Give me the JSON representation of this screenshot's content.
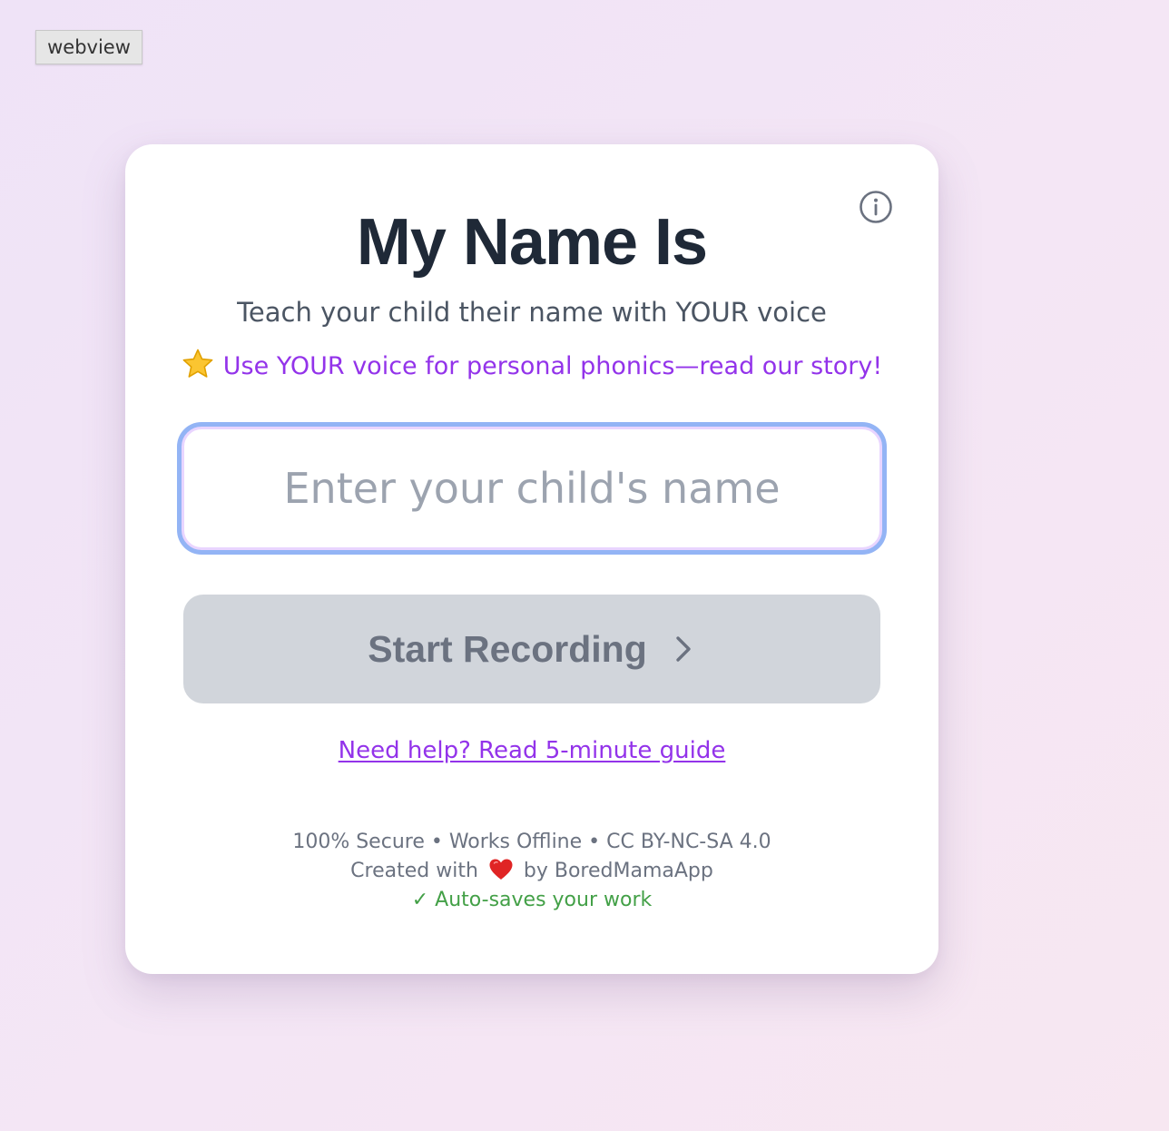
{
  "webview_label": "webview",
  "card": {
    "title": "My Name Is",
    "subtitle": "Teach your child their name with YOUR voice",
    "promo": {
      "icon": "star-icon",
      "text": "Use YOUR voice for personal phonics—read our story!"
    },
    "name_input": {
      "placeholder": "Enter your child's name",
      "value": ""
    },
    "start_button": {
      "label": "Start Recording",
      "icon": "chevron-right-icon",
      "enabled": false
    },
    "help_link": "Need help? Read 5-minute guide",
    "footer": {
      "badges": "100% Secure • Works Offline • CC BY-NC-SA 4.0",
      "created_prefix": "Created with",
      "created_icon": "heart-icon",
      "created_suffix": "by BoredMamaApp",
      "autosave": "✓ Auto-saves your work"
    },
    "info_icon": "info-icon"
  },
  "colors": {
    "title": "#1f2937",
    "accent_purple": "#9333ea",
    "button_disabled_bg": "#d1d5db",
    "button_disabled_text": "#6b7280",
    "input_focus_ring": "#93b4f5",
    "autosave_green": "#43a047"
  }
}
